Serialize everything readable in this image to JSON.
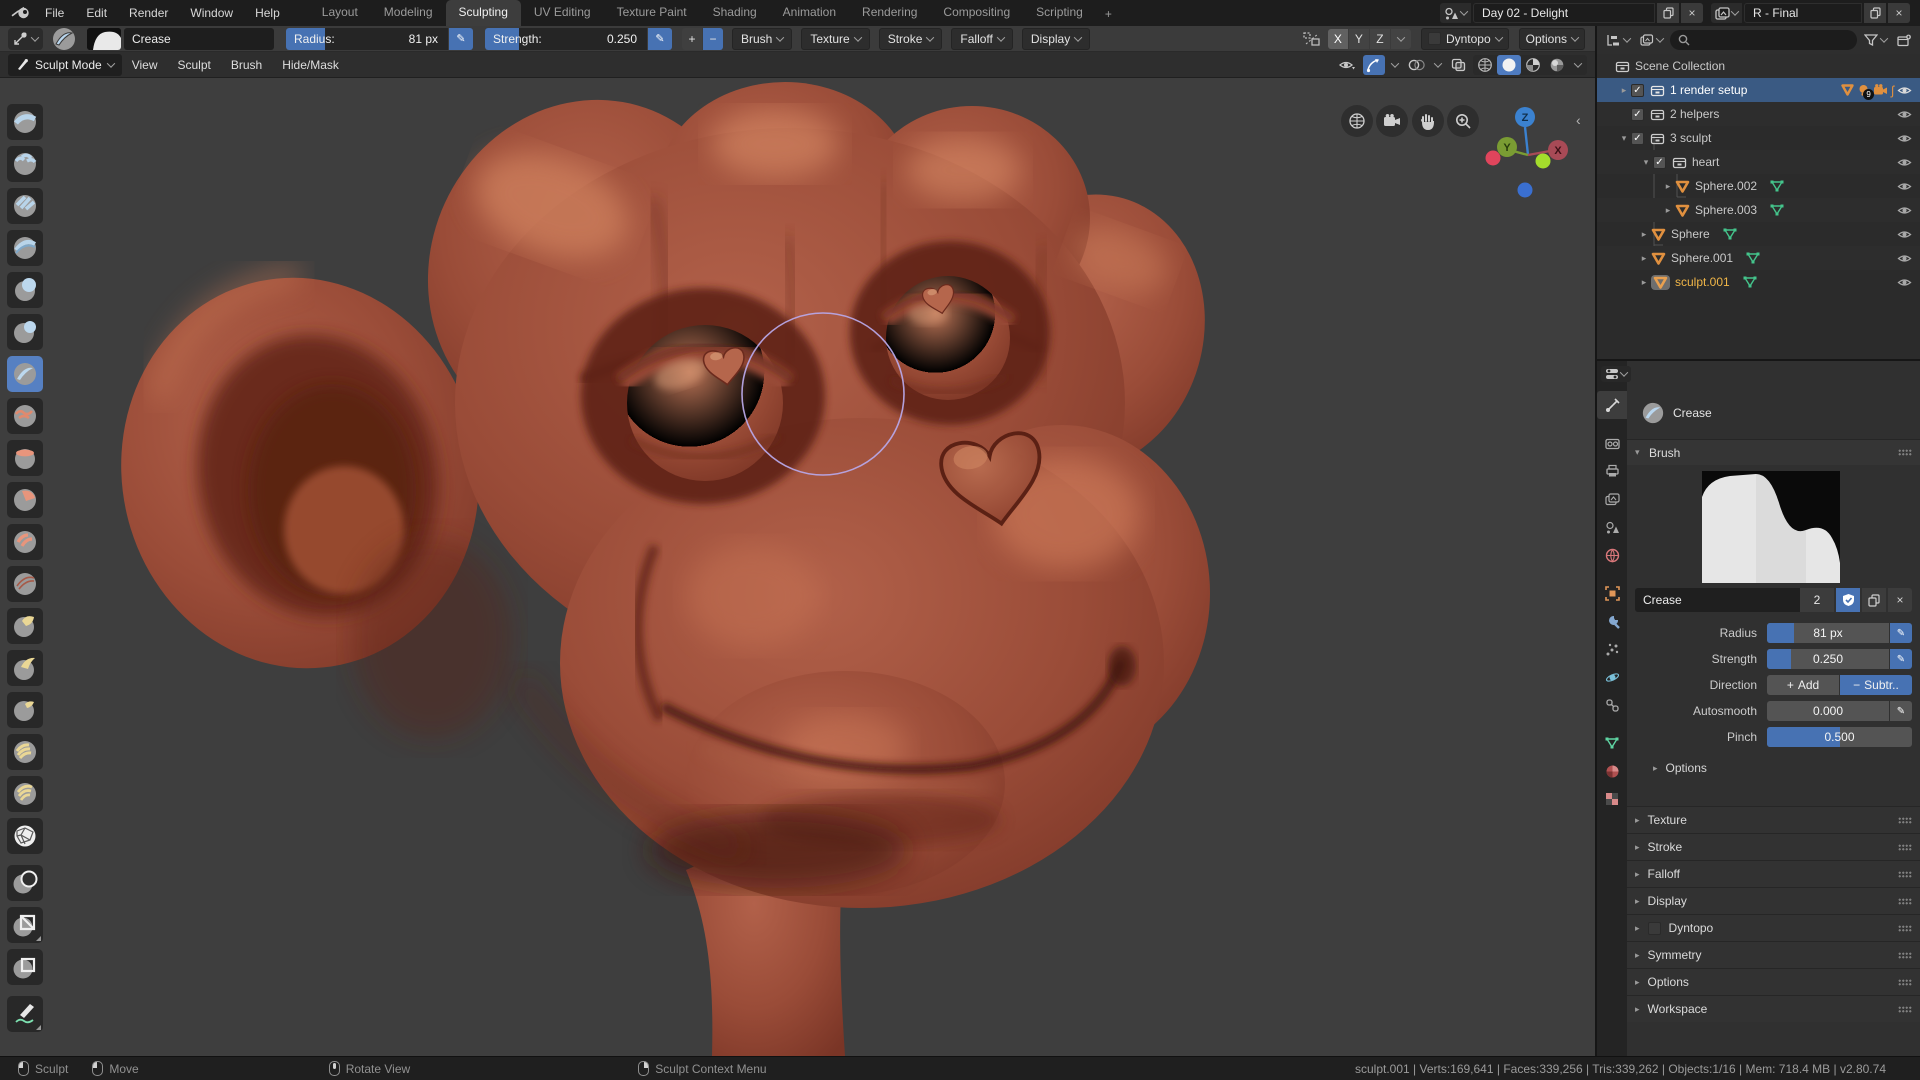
{
  "topbar": {
    "menus": [
      "File",
      "Edit",
      "Render",
      "Window",
      "Help"
    ],
    "tabs": [
      "Layout",
      "Modeling",
      "Sculpting",
      "UV Editing",
      "Texture Paint",
      "Shading",
      "Animation",
      "Rendering",
      "Compositing",
      "Scripting"
    ],
    "new_tab": "+",
    "scene_name": "Day 02 - Delight",
    "view_layer_name": "R - Final"
  },
  "tool_settings": {
    "brush_name": "Crease",
    "radius_label": "Radius:",
    "radius_value": "81 px",
    "strength_label": "Strength:",
    "strength_value": "0.250",
    "add_sign": "+",
    "subtract_sign": "−",
    "popovers": [
      "Brush",
      "Texture",
      "Stroke",
      "Falloff",
      "Display"
    ],
    "axis_x": "X",
    "axis_y": "Y",
    "axis_z": "Z",
    "dyntopo_label": "Dyntopo",
    "options_label": "Options"
  },
  "viewport": {
    "mode": "Sculpt Mode",
    "menus": [
      "View",
      "Sculpt",
      "Brush",
      "Hide/Mask"
    ],
    "gizmo": {
      "x": "X",
      "y": "Y",
      "z": "Z"
    },
    "brush_cursor_radius_px": 81,
    "tools": [
      "draw",
      "clay",
      "clay-strips",
      "layer",
      "inflate",
      "blob",
      "crease",
      "smooth",
      "flatten",
      "fill",
      "scrape",
      "pinch",
      "grab",
      "snake-hook",
      "thumb",
      "nudge",
      "rotate",
      "simplify",
      "mask",
      "box-hide",
      "box-mask",
      "annotate"
    ],
    "active_tool": "crease"
  },
  "outliner": {
    "rows": [
      {
        "label": "Scene Collection"
      },
      {
        "label": "1 render setup",
        "count_badge": "9"
      },
      {
        "label": "2 helpers"
      },
      {
        "label": "3 sculpt"
      },
      {
        "label": "heart"
      },
      {
        "label": "Sphere.002"
      },
      {
        "label": "Sphere.003"
      },
      {
        "label": "Sphere"
      },
      {
        "label": "Sphere.001"
      },
      {
        "label": "sculpt.001"
      }
    ]
  },
  "properties": {
    "breadcrumb": "Crease",
    "brush_panel_label": "Brush",
    "brush_name": "Crease",
    "brush_users": "2",
    "radius_label": "Radius",
    "radius_value": "81 px",
    "strength_label": "Strength",
    "strength_value": "0.250",
    "direction_label": "Direction",
    "direction_add": "Add",
    "direction_subtract": "Subtr..",
    "autosmooth_label": "Autosmooth",
    "autosmooth_value": "0.000",
    "pinch_label": "Pinch",
    "pinch_value": "0.500",
    "subpanel_options": "Options",
    "panels": [
      "Texture",
      "Stroke",
      "Falloff",
      "Display",
      "Dyntopo",
      "Symmetry",
      "Options",
      "Workspace"
    ]
  },
  "statusbar": {
    "hint_sculpt": "Sculpt",
    "hint_move": "Move",
    "hint_rotate": "Rotate View",
    "hint_context": "Sculpt Context Menu",
    "stats": "sculpt.001 | Verts:169,641 | Faces:339,256 | Tris:339,262 | Objects:1/16 | Mem: 718.4 MB | v2.80.74"
  },
  "colors": {
    "accent_blue": "#4772b3",
    "selection_blue": "#3a5a83",
    "active_text_orange": "#f0b648",
    "mesh_icon_orange": "#e0903f",
    "mesh_data_green": "#44c58c",
    "skin_base": "#9a4c38"
  }
}
